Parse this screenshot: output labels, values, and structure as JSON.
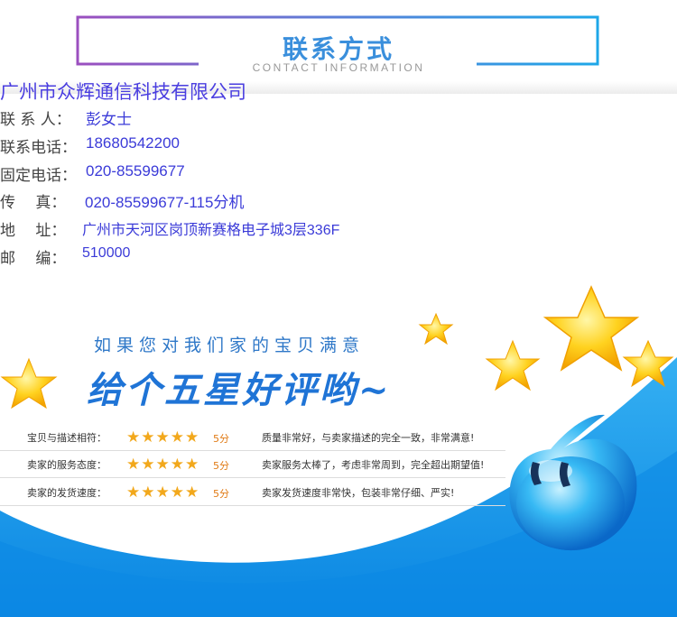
{
  "header": {
    "title": "联系方式",
    "subtitle": "CONTACT INFORMATION"
  },
  "company": "广州市众辉通信科技有限公司",
  "contacts": [
    {
      "label": "联 系 人：",
      "value": "彭女士"
    },
    {
      "label": "联系电话：",
      "value": "18680542200"
    },
    {
      "label": "固定电话：",
      "value": "020-85599677"
    },
    {
      "label": "传　 真：",
      "value": "020-85599677-115分机"
    },
    {
      "label": "地　 址：",
      "value": "广州市天河区岗顶新赛格电子城3层336F"
    },
    {
      "label": "邮　 编：",
      "value": "510000"
    }
  ],
  "banner": {
    "line1": "如果您对我们家的宝贝满意",
    "line2": "给个五星好评哟~",
    "ratings": [
      {
        "label": "宝贝与描述相符：",
        "stars": "★★★★★",
        "score": "5分",
        "desc": "质量非常好，与卖家描述的完全一致，非常满意!"
      },
      {
        "label": "卖家的服务态度：",
        "stars": "★★★★★",
        "score": "5分",
        "desc": "卖家服务太棒了，考虑非常周到，完全超出期望值!"
      },
      {
        "label": "卖家的发货速度：",
        "stars": "★★★★★",
        "score": "5分",
        "desc": "卖家发货速度非常快，包装非常仔细、严实!"
      }
    ]
  },
  "colors": {
    "accent_blue": "#3a8fdc",
    "frame_purple": "#9b4fbf",
    "wave_blue": "#0d8fe6",
    "star_gold": "#f2a81c"
  }
}
